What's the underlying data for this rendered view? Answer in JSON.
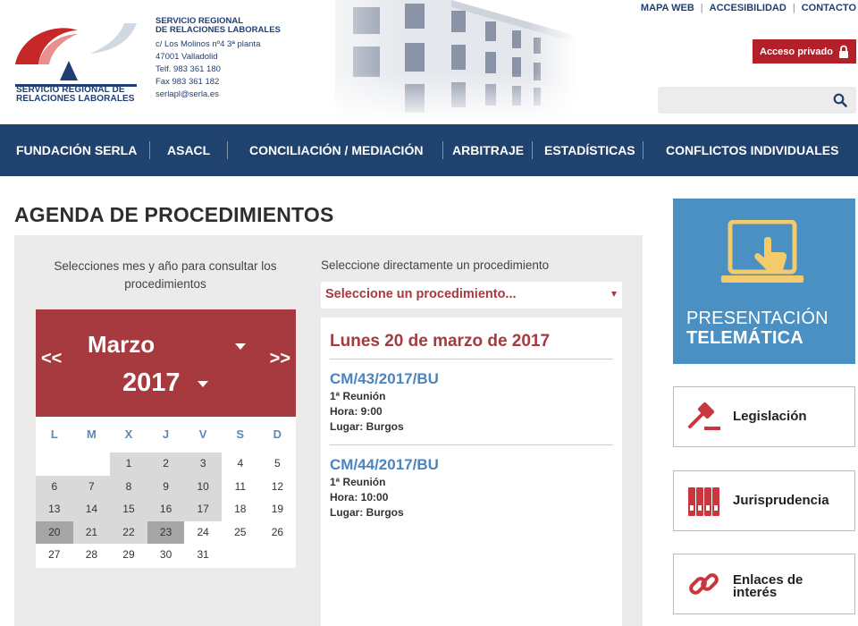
{
  "header": {
    "logo_text_1": "SERVICIO REGIONAL DE",
    "logo_text_2": "RELACIONES LABORALES",
    "org_line_1": "SERVICIO REGIONAL",
    "org_line_2": "DE RELACIONES LABORALES",
    "address": "c/ Los Molinos nº4 3ª planta",
    "postal": "47001 Valladolid",
    "phone": "Telf. 983 361 180",
    "fax": "Fax 983 361 182",
    "email": "serlapl@serla.es",
    "toplinks": [
      "MAPA WEB",
      "ACCESIBILIDAD",
      "CONTACTO"
    ],
    "access_label": "Acceso privado",
    "search_placeholder": ""
  },
  "nav": [
    "FUNDACIÓN SERLA",
    "ASACL",
    "CONCILIACIÓN / MEDIACIÓN",
    "ARBITRAJE",
    "ESTADÍSTICAS",
    "CONFLICTOS INDIVIDUALES"
  ],
  "main": {
    "title": "AGENDA DE PROCEDIMIENTOS",
    "calendar_intro": "Selecciones mes y año para consultar los procedimientos",
    "proc_intro": "Seleccione directamente un procedimiento",
    "proc_select": "Seleccione un procedimiento..."
  },
  "calendar": {
    "prev": "<<",
    "next": ">>",
    "month": "Marzo",
    "year": "2017",
    "weekdays": [
      "L",
      "M",
      "X",
      "J",
      "V",
      "S",
      "D"
    ],
    "first_weekday_index": 2,
    "days_in_month": 31,
    "days_with_procedures": [
      1,
      2,
      3,
      6,
      7,
      8,
      9,
      10,
      13,
      14,
      15,
      16,
      17,
      20,
      21,
      22,
      23
    ],
    "highlighted_days": [
      20,
      23
    ]
  },
  "detail": {
    "date": "Lunes 20 de marzo de 2017",
    "procedures": [
      {
        "code": "CM/43/2017/BU",
        "meeting": "1ª Reunión",
        "time": "Hora: 9:00",
        "place": "Lugar: Burgos"
      },
      {
        "code": "CM/44/2017/BU",
        "meeting": "1ª Reunión",
        "time": "Hora: 10:00",
        "place": "Lugar: Burgos"
      }
    ]
  },
  "sidebar": {
    "telematica_1": "PRESENTACIÓN",
    "telematica_2": "TELEMÁTICA",
    "legislacion": "Legislación",
    "jurisprudencia": "Jurisprudencia",
    "enlaces_1": "Enlaces de",
    "enlaces_2": "interés",
    "icons": [
      "monitor-hand-icon",
      "gavel-icon",
      "binders-icon",
      "chain-link-icon"
    ]
  },
  "colors": {
    "nav": "#20426f",
    "calendar_header": "#a63a3e",
    "accent_blue": "#4a85bf",
    "access_red": "#b4202a",
    "telematica": "#4a90c2"
  }
}
